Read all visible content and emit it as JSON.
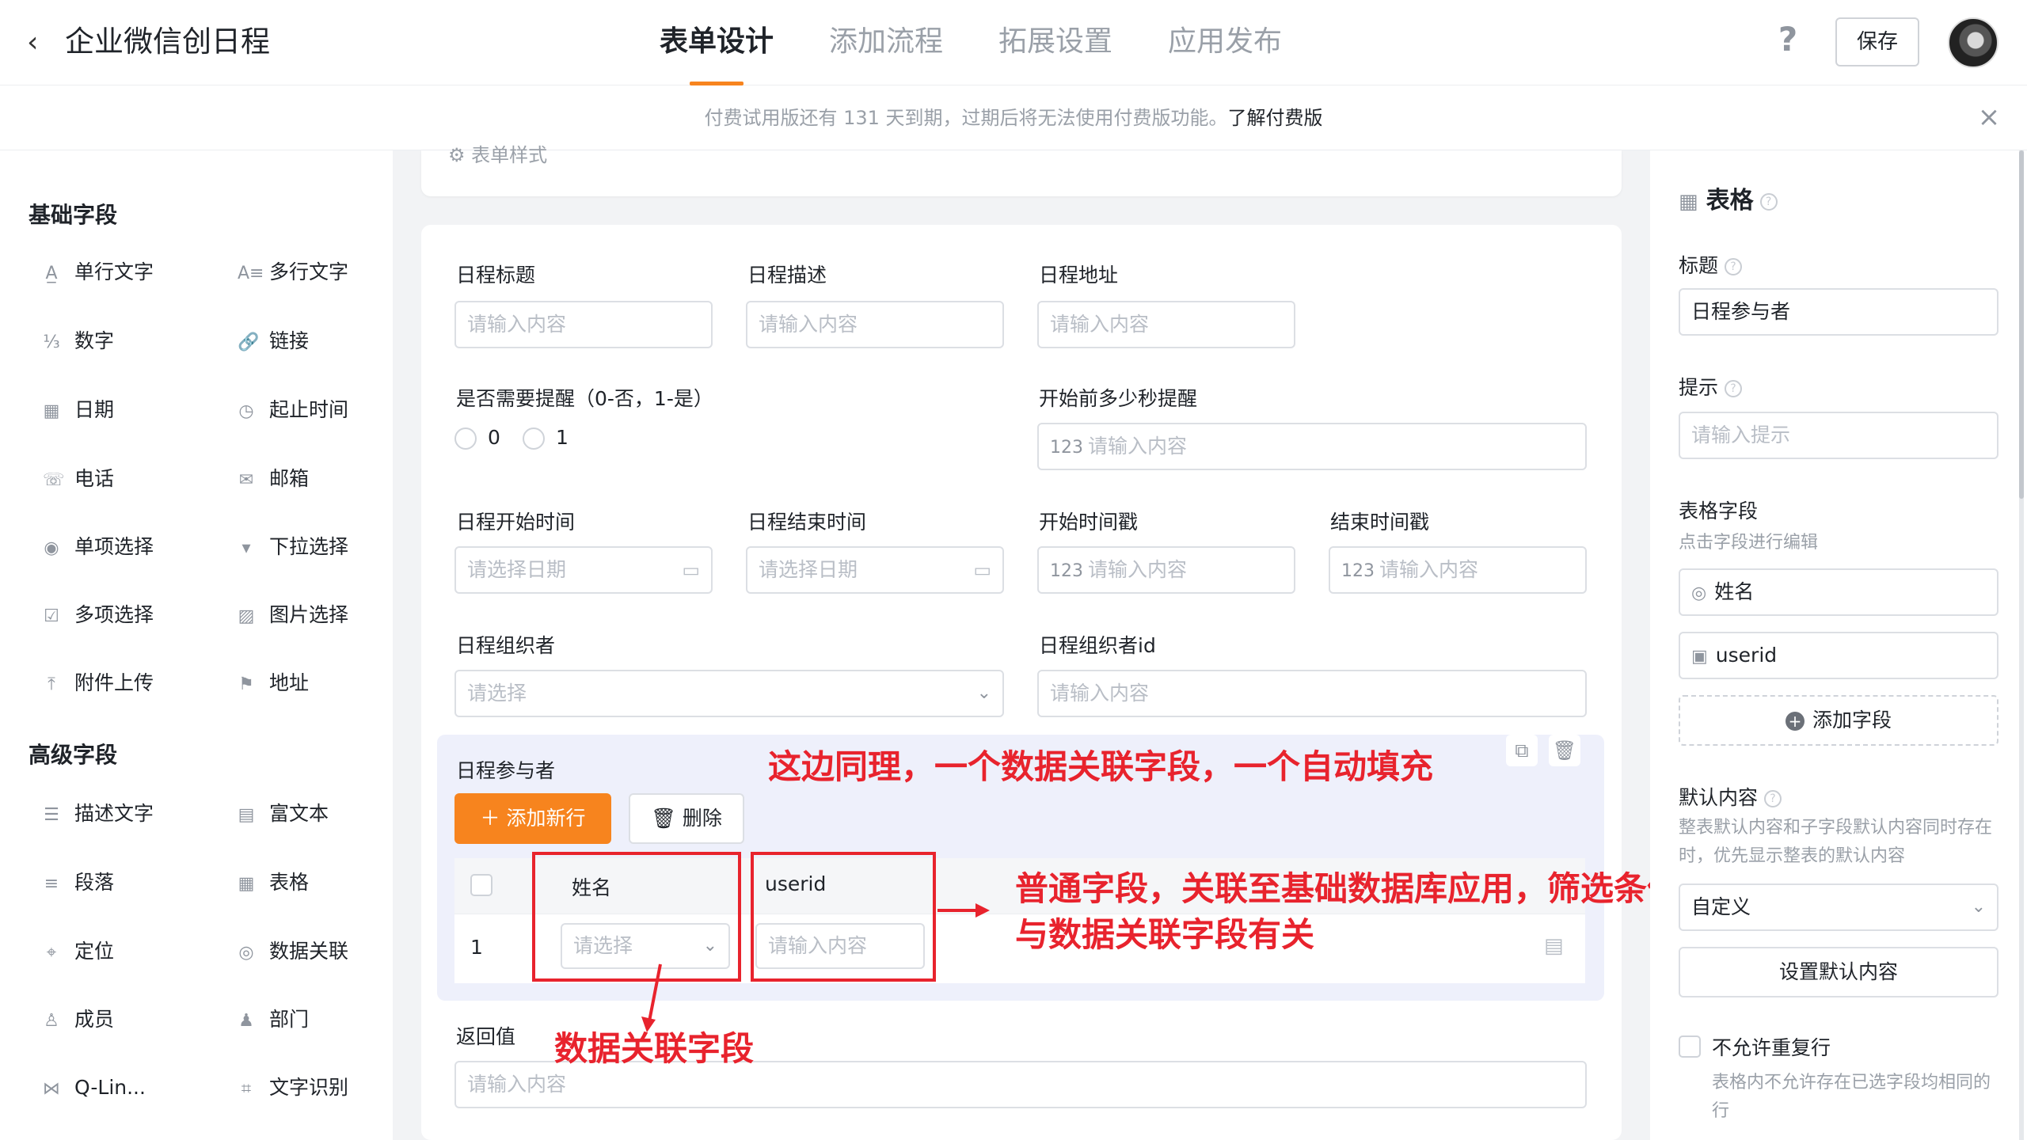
{
  "header": {
    "back_icon": "chevron-left-icon",
    "app_title": "企业微信创日程",
    "tabs": [
      {
        "label": "表单设计",
        "active": true
      },
      {
        "label": "添加流程",
        "active": false
      },
      {
        "label": "拓展设置",
        "active": false
      },
      {
        "label": "应用发布",
        "active": false
      }
    ],
    "help_label": "?",
    "save_label": "保存",
    "accent_color": "#f7841e"
  },
  "notice": {
    "text": "付费试用版还有 131 天到期，过期后将无法使用付费版功能。",
    "link": "了解付费版",
    "close": "×"
  },
  "left": {
    "basic_title": "基础字段",
    "basic": [
      {
        "icon": "A̲",
        "label": "单行文字"
      },
      {
        "icon": "A≡",
        "label": "多行文字"
      },
      {
        "icon": "⅓",
        "label": "数字"
      },
      {
        "icon": "🔗",
        "label": "链接"
      },
      {
        "icon": "▦",
        "label": "日期"
      },
      {
        "icon": "◷",
        "label": "起止时间"
      },
      {
        "icon": "☏",
        "label": "电话"
      },
      {
        "icon": "✉",
        "label": "邮箱"
      },
      {
        "icon": "◉",
        "label": "单项选择"
      },
      {
        "icon": "▾",
        "label": "下拉选择"
      },
      {
        "icon": "☑",
        "label": "多项选择"
      },
      {
        "icon": "▨",
        "label": "图片选择"
      },
      {
        "icon": "⤒",
        "label": "附件上传"
      },
      {
        "icon": "⚑",
        "label": "地址"
      }
    ],
    "advanced_title": "高级字段",
    "advanced": [
      {
        "icon": "☰",
        "label": "描述文字"
      },
      {
        "icon": "▤",
        "label": "富文本"
      },
      {
        "icon": "≡",
        "label": "段落"
      },
      {
        "icon": "▦",
        "label": "表格"
      },
      {
        "icon": "⌖",
        "label": "定位"
      },
      {
        "icon": "◎",
        "label": "数据关联"
      },
      {
        "icon": "♙",
        "label": "成员"
      },
      {
        "icon": "♟",
        "label": "部门"
      },
      {
        "icon": "⋈",
        "label": "Q-Lin..."
      },
      {
        "icon": "⌗",
        "label": "文字识别"
      }
    ]
  },
  "form": {
    "style_label": "表单样式",
    "placeholder": "请输入内容",
    "date_placeholder": "请选择日期",
    "select_placeholder": "请选择",
    "fields": {
      "title": "日程标题",
      "desc": "日程描述",
      "address": "日程地址",
      "remind": "是否需要提醒（0-否，1-是）",
      "remind_opt0": "0",
      "remind_opt1": "1",
      "remind_seconds": "开始前多少秒提醒",
      "start_time": "日程开始时间",
      "end_time": "日程结束时间",
      "start_ts": "开始时间戳",
      "end_ts": "结束时间戳",
      "organizer": "日程组织者",
      "organizer_id": "日程组织者id",
      "participants": "日程参与者",
      "return_value": "返回值"
    },
    "num_icon": "123",
    "table": {
      "add_row": "添加新行",
      "delete": "删除",
      "col_name": "姓名",
      "col_userid": "userid",
      "row_index": "1"
    }
  },
  "annotations": {
    "top": "这边同理，一个数据关联字段，一个自动填充",
    "right_line1": "普通字段，关联至基础数据库应用，筛选条件",
    "right_line2": "与数据关联字段有关",
    "bottom": "数据关联字段",
    "color": "#e8232d"
  },
  "right": {
    "title": "表格",
    "label_title": "标题",
    "title_value": "日程参与者",
    "label_hint": "提示",
    "hint_placeholder": "请输入提示",
    "label_fields": "表格字段",
    "fields_sub": "点击字段进行编辑",
    "field_items": [
      "姓名",
      "userid"
    ],
    "add_field": "添加字段",
    "label_default": "默认内容",
    "default_sub": "整表默认内容和子字段默认内容同时存在时，优先显示整表的默认内容",
    "default_value": "自定义",
    "set_default": "设置默认内容",
    "no_dup": "不允许重复行",
    "no_dup_sub": "表格内不允许存在已选字段均相同的行"
  }
}
